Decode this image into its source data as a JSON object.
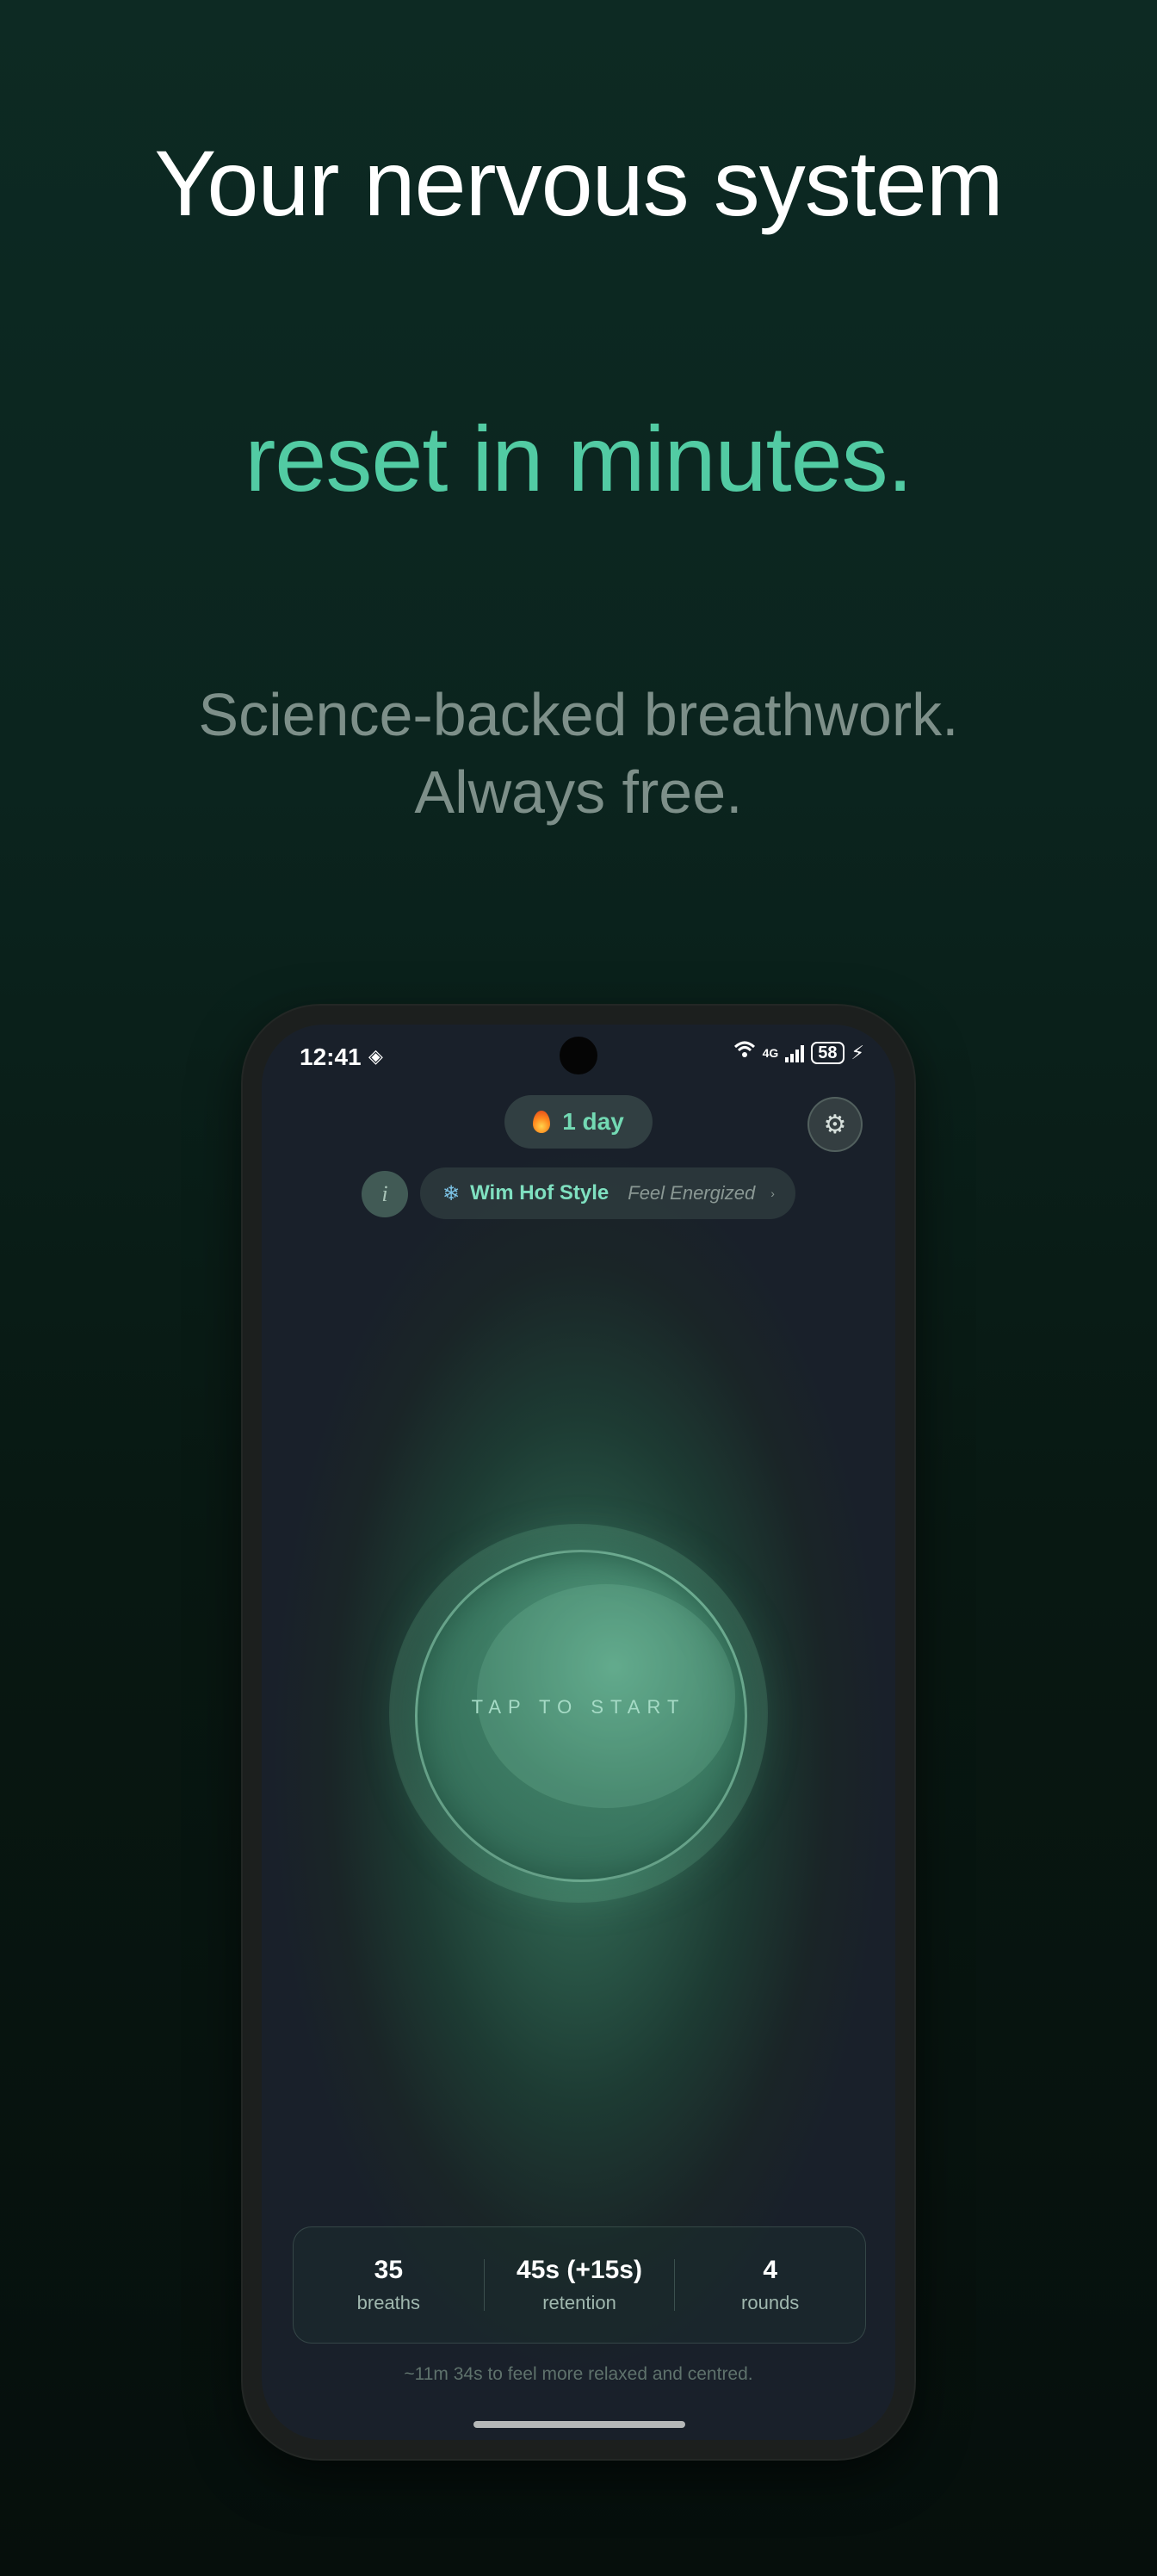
{
  "headline": {
    "line1": "Your nervous system",
    "line2": "reset in minutes.",
    "sub_line1": "Science-backed breathwork.",
    "sub_line2": "Always free."
  },
  "status_bar": {
    "time": "12:41",
    "network": "4G",
    "battery": "58"
  },
  "streak": {
    "label": "1 day"
  },
  "technique": {
    "name": "Wim Hof Style",
    "mood": "Feel Energized"
  },
  "orb": {
    "label": "TAP TO START"
  },
  "stats": [
    {
      "value": "35",
      "label": "breaths"
    },
    {
      "value": "45s (+15s)",
      "label": "retention"
    },
    {
      "value": "4",
      "label": "rounds"
    }
  ],
  "summary": "~11m 34s to feel more relaxed and centred.",
  "colors": {
    "accent": "#52cba3",
    "background": "#0b241e"
  }
}
